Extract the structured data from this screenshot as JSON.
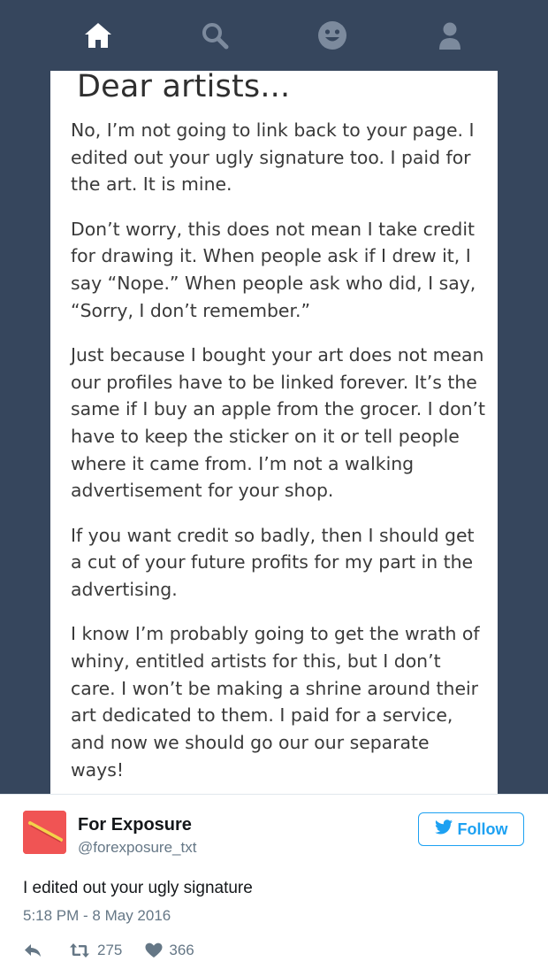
{
  "nav": {
    "items": [
      {
        "icon": "home-icon"
      },
      {
        "icon": "search-icon"
      },
      {
        "icon": "smiley-icon"
      },
      {
        "icon": "account-icon"
      }
    ],
    "active_color": "#ffffff",
    "inactive_color": "#7c8a9d"
  },
  "post": {
    "title": "Dear artists...",
    "paragraphs": [
      "No, I’m not going to link back to your page. I edited out your ugly signature too. I paid for the art. It is mine.",
      "Don’t worry, this does not mean I take credit for drawing it. When people ask if I drew it, I say “Nope.” When people ask who did, I say, “Sorry, I don’t remember.”",
      "Just because I bought your art does not mean our profiles have to be linked forever. It’s the same if I buy an apple from the grocer. I don’t have to keep the sticker on it or tell people where it came from. I’m not a walking advertisement for your shop.",
      "If you want credit so badly, then I should get a cut of your future profits for my part in the advertising.",
      "I know I’m probably going to get the wrath of whiny, entitled artists for this, but I don’t care. I won’t be making a shrine around their art dedicated to them. I paid for a service, and now we should go our our separate ways!"
    ]
  },
  "tweet": {
    "display_name": "For Exposure",
    "handle": "@forexposure_txt",
    "follow_label": "Follow",
    "text": "I edited out your ugly signature",
    "timestamp": "5:18 PM - 8 May 2016",
    "retweets": "275",
    "likes": "366",
    "avatar_color": "#f05454",
    "brand_color": "#1da1f2"
  }
}
